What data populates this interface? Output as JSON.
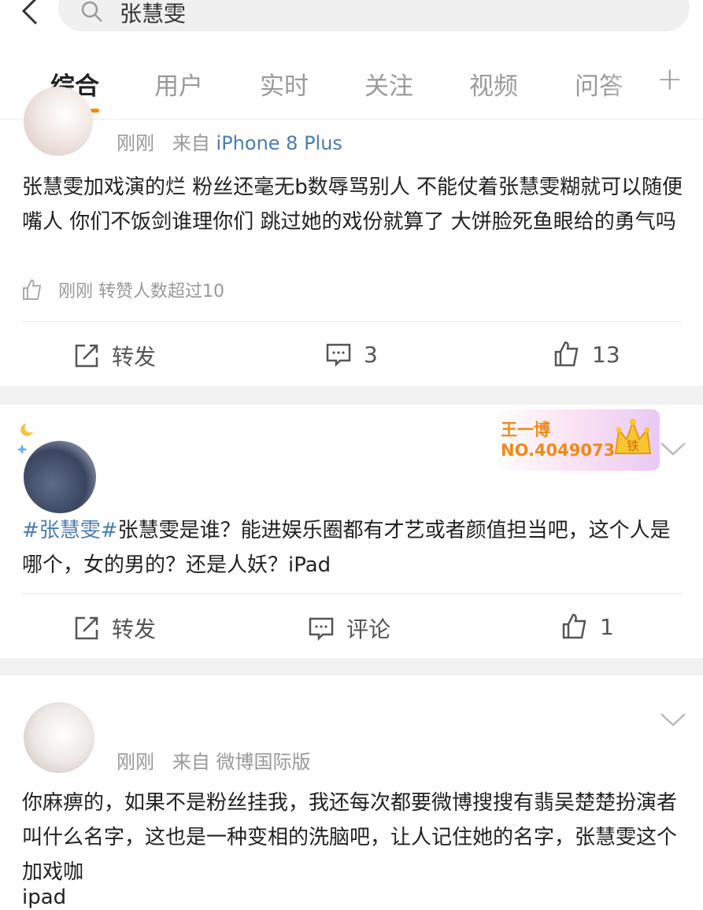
{
  "search": {
    "query": "张慧雯"
  },
  "tabs": [
    {
      "label": "综合",
      "active": true
    },
    {
      "label": "用户"
    },
    {
      "label": "实时"
    },
    {
      "label": "关注"
    },
    {
      "label": "视频"
    },
    {
      "label": "问答"
    }
  ],
  "posts": [
    {
      "time": "刚刚",
      "source_prefix": "来自",
      "source": "iPhone 8 Plus",
      "text": "张慧雯加戏演的烂 粉丝还毫无b数辱骂别人 不能仗着张慧雯糊就可以随便嘴人 你们不饭剑谁理你们 跳过她的戏份就算了 大饼脸死鱼眼给的勇气吗",
      "like_note_time": "刚刚",
      "like_note": "转赞人数超过10",
      "repost_label": "转发",
      "comment_label": "3",
      "like_label": "13"
    },
    {
      "badge_name": "王一博",
      "badge_no": "NO.4049073",
      "badge_crown": "铁",
      "hashtag": "#张慧雯#",
      "text": "张慧雯是谁？能进娱乐圈都有才艺或者颜值担当吧，这个人是哪个，女的男的？还是人妖？iPad",
      "repost_label": "转发",
      "comment_label": "评论",
      "like_label": "1"
    },
    {
      "time": "刚刚",
      "source_prefix": "来自",
      "source": "微博国际版",
      "text": "你麻痹的，如果不是粉丝挂我，我还每次都要微博搜搜有翡吴楚楚扮演者叫什么名字，这也是一种变相的洗脑吧，让人记住她的名字，张慧雯这个加戏咖",
      "text2": "ipad"
    }
  ],
  "colors": {
    "accent": "#ff8200",
    "link": "#4a7cb3"
  }
}
